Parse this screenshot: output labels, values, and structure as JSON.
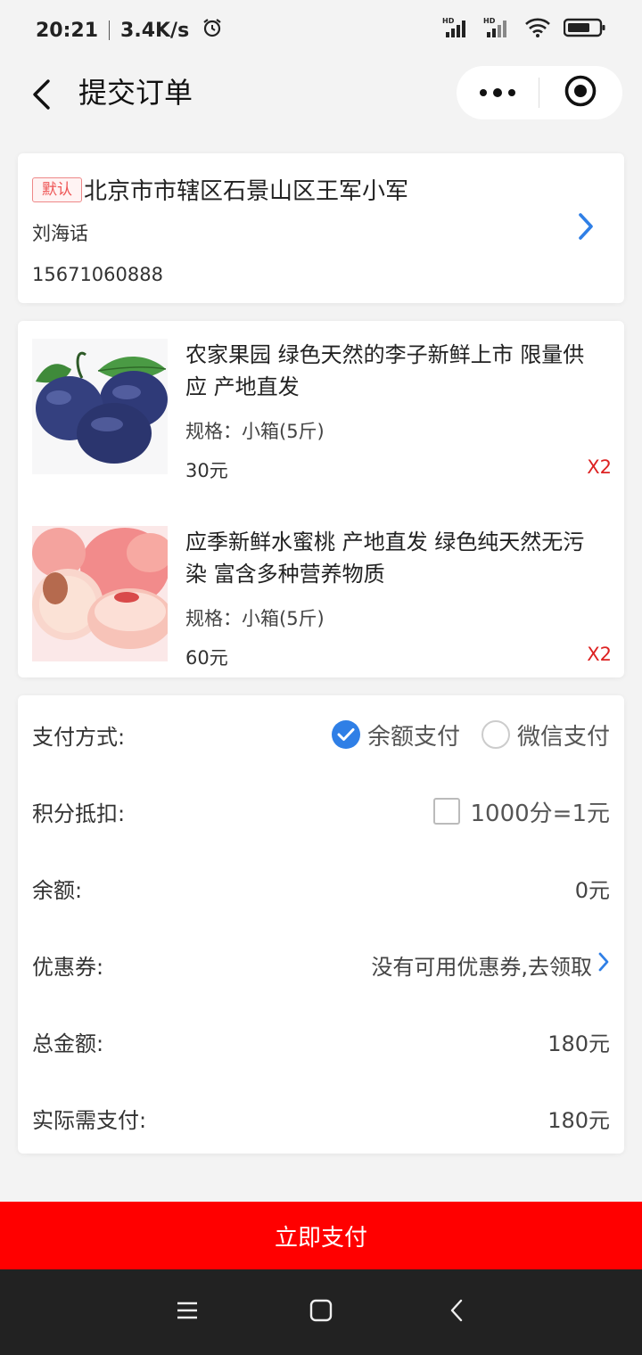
{
  "status_bar": {
    "time": "20:21",
    "speed": "3.4K/s",
    "icons": [
      "alarm-icon",
      "hd-signal-icon",
      "hd-signal-icon",
      "wifi-icon",
      "battery-icon"
    ]
  },
  "nav": {
    "title": "提交订单",
    "back_icon": "chevron-left-icon",
    "menu_icon": "more-dots-icon",
    "close_icon": "target-circle-icon"
  },
  "address": {
    "tag": "默认",
    "text": "北京市市辖区石景山区王军小军",
    "name": "刘海话",
    "phone": "15671060888"
  },
  "goods": [
    {
      "title": "农家果园 绿色天然的李子新鲜上市 限量供应 产地直发",
      "spec": "规格：小箱(5斤)",
      "price": "30元",
      "qty": "X2",
      "image": "plums-image"
    },
    {
      "title": "应季新鲜水蜜桃 产地直发 绿色纯天然无污染 富含多种营养物质",
      "spec": "规格：小箱(5斤)",
      "price": "60元",
      "qty": "X2",
      "image": "peaches-image"
    }
  ],
  "payment": {
    "method_label": "支付方式:",
    "option_balance": "余额支付",
    "option_wechat": "微信支付",
    "selected": "余额支付",
    "points_label": "积分抵扣:",
    "points_value": "1000分=1元",
    "points_checked": false,
    "balance_label": "余额:",
    "balance_value": "0元",
    "coupon_label": "优惠券:",
    "coupon_value": "没有可用优惠券,去领取",
    "total_label": "总金额:",
    "total_value": "180元",
    "actual_label": "实际需支付:",
    "actual_value": "180元"
  },
  "pay_button": "立即支付",
  "colors": {
    "accent": "#2f7fe6",
    "pay_button": "#ff0000",
    "quantity": "#dd2222"
  }
}
